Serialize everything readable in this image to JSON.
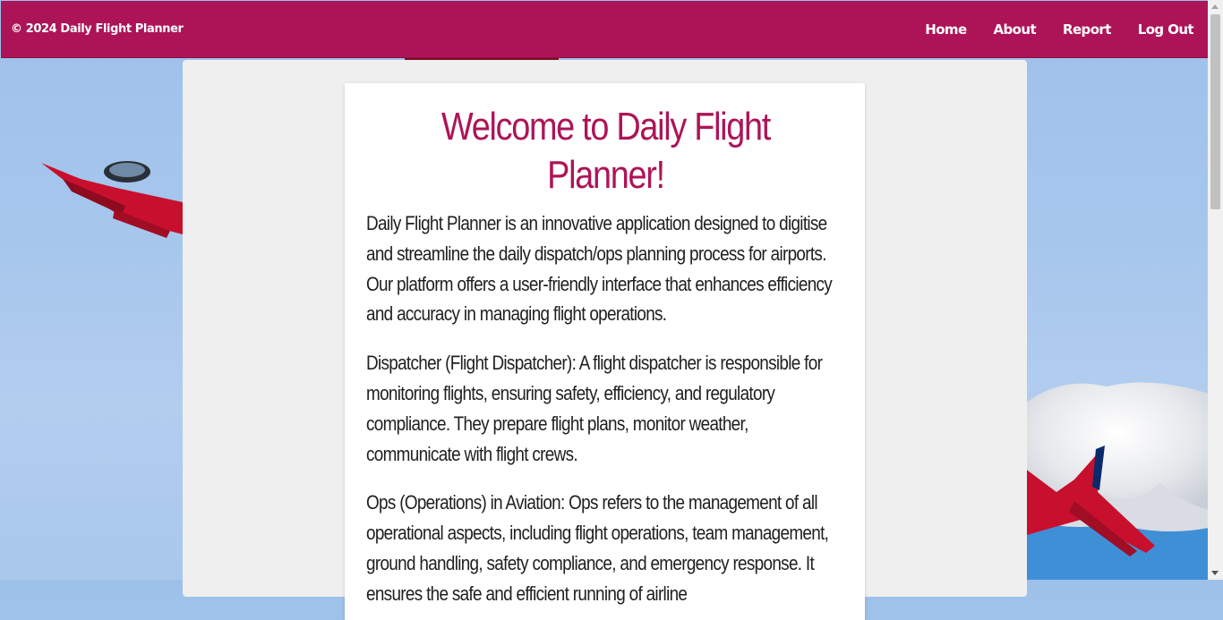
{
  "header": {
    "brand": "© 2024 Daily Flight Planner",
    "nav": [
      {
        "label": "Home"
      },
      {
        "label": "About"
      },
      {
        "label": "Report"
      },
      {
        "label": "Log Out"
      }
    ],
    "background_color": "#ad1457"
  },
  "main": {
    "title": "Welcome to Daily Flight Planner!",
    "paragraphs": [
      "Daily Flight Planner is an innovative application designed to digitise and streamline the daily dispatch/ops planning process for airports. Our platform offers a user-friendly interface that enhances efficiency and accuracy in managing flight operations.",
      "Dispatcher (Flight Dispatcher): A flight dispatcher is responsible for monitoring flights, ensuring safety, efficiency, and regulatory compliance. They prepare flight plans, monitor weather, communicate with flight crews.",
      "Ops (Operations) in Aviation: Ops refers to the management of all operational aspects, including flight operations, team management, ground handling, safety compliance, and emergency response. It ensures the safe and efficient running of airline"
    ],
    "accent_color": "#ad1457"
  }
}
